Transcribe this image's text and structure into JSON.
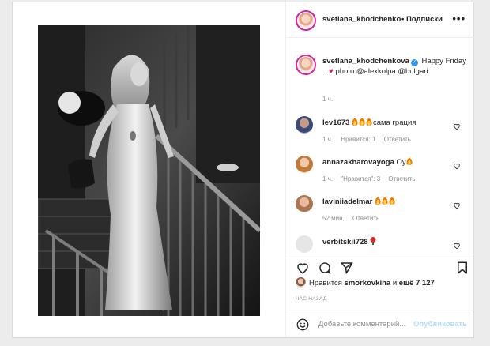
{
  "post": {
    "username": "svetlana_khodchenkova",
    "header_username": "svetlana_khodchenkov",
    "follow_label": "• Подписки",
    "more_label": "•••",
    "caption_rest_before": " Happy Friday ...",
    "caption_rest_after": " photo @alexkolpa @bulgari",
    "caption_time": "1 ч.",
    "likes_prefix": "Нравится ",
    "likes_user": "smorkovkina",
    "likes_mid": " и ",
    "likes_count": "ещё 7 127",
    "posted_label": "ЧАС НАЗАД",
    "comment_placeholder": "Добавьте комментарий...",
    "publish_label": "Опубликовать"
  },
  "comments": [
    {
      "user": "lev1673",
      "text": "сама грация",
      "fires": 3,
      "time": "1 ч.",
      "likes": "Нравится: 1",
      "reply": "Ответить"
    },
    {
      "user": "annazakharovayoga",
      "text": "Оу",
      "fires": 1,
      "time": "1 ч.",
      "likes": "\"Нравится\": 3",
      "reply": "Ответить"
    },
    {
      "user": "laviniiadelmar",
      "text": "",
      "fires": 3,
      "time": "52 мин.",
      "likes": "",
      "reply": "Ответить"
    },
    {
      "user": "verbitskii728",
      "text": "",
      "fires": 0,
      "time": "",
      "likes": "",
      "reply": ""
    }
  ],
  "icons": {
    "like": "heart-outline-icon",
    "comment": "comment-bubble-icon",
    "share": "paper-plane-icon",
    "save": "bookmark-icon",
    "emoji": "smiley-icon",
    "verified": "verified-badge-icon"
  },
  "colors": {
    "accent": "#3897f0",
    "publish_disabled": "#b2dffc",
    "meta": "#8e8e8e"
  }
}
